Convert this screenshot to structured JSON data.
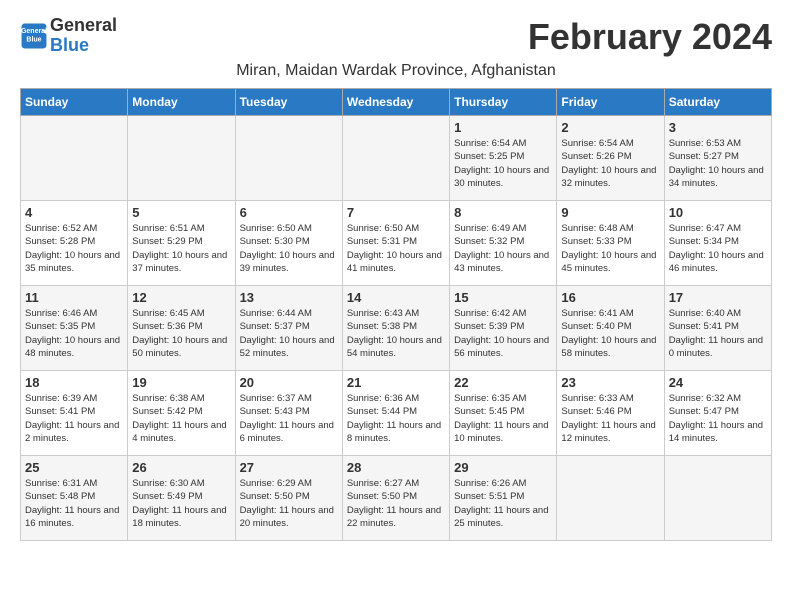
{
  "header": {
    "logo_line1": "General",
    "logo_line2": "Blue",
    "month_year": "February 2024",
    "subtitle": "Miran, Maidan Wardak Province, Afghanistan"
  },
  "weekdays": [
    "Sunday",
    "Monday",
    "Tuesday",
    "Wednesday",
    "Thursday",
    "Friday",
    "Saturday"
  ],
  "weeks": [
    [
      {
        "day": "",
        "sunrise": "",
        "sunset": "",
        "daylight": ""
      },
      {
        "day": "",
        "sunrise": "",
        "sunset": "",
        "daylight": ""
      },
      {
        "day": "",
        "sunrise": "",
        "sunset": "",
        "daylight": ""
      },
      {
        "day": "",
        "sunrise": "",
        "sunset": "",
        "daylight": ""
      },
      {
        "day": "1",
        "sunrise": "Sunrise: 6:54 AM",
        "sunset": "Sunset: 5:25 PM",
        "daylight": "Daylight: 10 hours and 30 minutes."
      },
      {
        "day": "2",
        "sunrise": "Sunrise: 6:54 AM",
        "sunset": "Sunset: 5:26 PM",
        "daylight": "Daylight: 10 hours and 32 minutes."
      },
      {
        "day": "3",
        "sunrise": "Sunrise: 6:53 AM",
        "sunset": "Sunset: 5:27 PM",
        "daylight": "Daylight: 10 hours and 34 minutes."
      }
    ],
    [
      {
        "day": "4",
        "sunrise": "Sunrise: 6:52 AM",
        "sunset": "Sunset: 5:28 PM",
        "daylight": "Daylight: 10 hours and 35 minutes."
      },
      {
        "day": "5",
        "sunrise": "Sunrise: 6:51 AM",
        "sunset": "Sunset: 5:29 PM",
        "daylight": "Daylight: 10 hours and 37 minutes."
      },
      {
        "day": "6",
        "sunrise": "Sunrise: 6:50 AM",
        "sunset": "Sunset: 5:30 PM",
        "daylight": "Daylight: 10 hours and 39 minutes."
      },
      {
        "day": "7",
        "sunrise": "Sunrise: 6:50 AM",
        "sunset": "Sunset: 5:31 PM",
        "daylight": "Daylight: 10 hours and 41 minutes."
      },
      {
        "day": "8",
        "sunrise": "Sunrise: 6:49 AM",
        "sunset": "Sunset: 5:32 PM",
        "daylight": "Daylight: 10 hours and 43 minutes."
      },
      {
        "day": "9",
        "sunrise": "Sunrise: 6:48 AM",
        "sunset": "Sunset: 5:33 PM",
        "daylight": "Daylight: 10 hours and 45 minutes."
      },
      {
        "day": "10",
        "sunrise": "Sunrise: 6:47 AM",
        "sunset": "Sunset: 5:34 PM",
        "daylight": "Daylight: 10 hours and 46 minutes."
      }
    ],
    [
      {
        "day": "11",
        "sunrise": "Sunrise: 6:46 AM",
        "sunset": "Sunset: 5:35 PM",
        "daylight": "Daylight: 10 hours and 48 minutes."
      },
      {
        "day": "12",
        "sunrise": "Sunrise: 6:45 AM",
        "sunset": "Sunset: 5:36 PM",
        "daylight": "Daylight: 10 hours and 50 minutes."
      },
      {
        "day": "13",
        "sunrise": "Sunrise: 6:44 AM",
        "sunset": "Sunset: 5:37 PM",
        "daylight": "Daylight: 10 hours and 52 minutes."
      },
      {
        "day": "14",
        "sunrise": "Sunrise: 6:43 AM",
        "sunset": "Sunset: 5:38 PM",
        "daylight": "Daylight: 10 hours and 54 minutes."
      },
      {
        "day": "15",
        "sunrise": "Sunrise: 6:42 AM",
        "sunset": "Sunset: 5:39 PM",
        "daylight": "Daylight: 10 hours and 56 minutes."
      },
      {
        "day": "16",
        "sunrise": "Sunrise: 6:41 AM",
        "sunset": "Sunset: 5:40 PM",
        "daylight": "Daylight: 10 hours and 58 minutes."
      },
      {
        "day": "17",
        "sunrise": "Sunrise: 6:40 AM",
        "sunset": "Sunset: 5:41 PM",
        "daylight": "Daylight: 11 hours and 0 minutes."
      }
    ],
    [
      {
        "day": "18",
        "sunrise": "Sunrise: 6:39 AM",
        "sunset": "Sunset: 5:41 PM",
        "daylight": "Daylight: 11 hours and 2 minutes."
      },
      {
        "day": "19",
        "sunrise": "Sunrise: 6:38 AM",
        "sunset": "Sunset: 5:42 PM",
        "daylight": "Daylight: 11 hours and 4 minutes."
      },
      {
        "day": "20",
        "sunrise": "Sunrise: 6:37 AM",
        "sunset": "Sunset: 5:43 PM",
        "daylight": "Daylight: 11 hours and 6 minutes."
      },
      {
        "day": "21",
        "sunrise": "Sunrise: 6:36 AM",
        "sunset": "Sunset: 5:44 PM",
        "daylight": "Daylight: 11 hours and 8 minutes."
      },
      {
        "day": "22",
        "sunrise": "Sunrise: 6:35 AM",
        "sunset": "Sunset: 5:45 PM",
        "daylight": "Daylight: 11 hours and 10 minutes."
      },
      {
        "day": "23",
        "sunrise": "Sunrise: 6:33 AM",
        "sunset": "Sunset: 5:46 PM",
        "daylight": "Daylight: 11 hours and 12 minutes."
      },
      {
        "day": "24",
        "sunrise": "Sunrise: 6:32 AM",
        "sunset": "Sunset: 5:47 PM",
        "daylight": "Daylight: 11 hours and 14 minutes."
      }
    ],
    [
      {
        "day": "25",
        "sunrise": "Sunrise: 6:31 AM",
        "sunset": "Sunset: 5:48 PM",
        "daylight": "Daylight: 11 hours and 16 minutes."
      },
      {
        "day": "26",
        "sunrise": "Sunrise: 6:30 AM",
        "sunset": "Sunset: 5:49 PM",
        "daylight": "Daylight: 11 hours and 18 minutes."
      },
      {
        "day": "27",
        "sunrise": "Sunrise: 6:29 AM",
        "sunset": "Sunset: 5:50 PM",
        "daylight": "Daylight: 11 hours and 20 minutes."
      },
      {
        "day": "28",
        "sunrise": "Sunrise: 6:27 AM",
        "sunset": "Sunset: 5:50 PM",
        "daylight": "Daylight: 11 hours and 22 minutes."
      },
      {
        "day": "29",
        "sunrise": "Sunrise: 6:26 AM",
        "sunset": "Sunset: 5:51 PM",
        "daylight": "Daylight: 11 hours and 25 minutes."
      },
      {
        "day": "",
        "sunrise": "",
        "sunset": "",
        "daylight": ""
      },
      {
        "day": "",
        "sunrise": "",
        "sunset": "",
        "daylight": ""
      }
    ]
  ]
}
